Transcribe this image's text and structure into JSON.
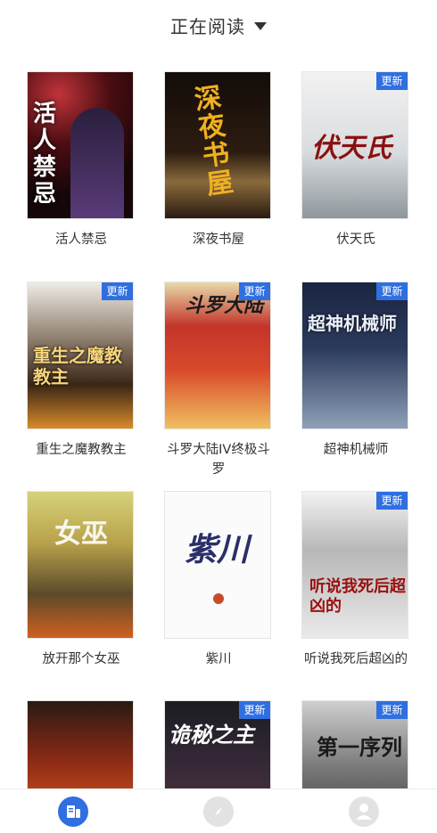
{
  "header": {
    "title": "正在阅读"
  },
  "books": [
    {
      "title": "活人禁忌",
      "cover_text": "活人禁忌",
      "badge": ""
    },
    {
      "title": "深夜书屋",
      "cover_text": "深夜书屋",
      "badge": ""
    },
    {
      "title": "伏天氏",
      "cover_text": "伏天氏",
      "badge": "更新"
    },
    {
      "title": "重生之魔教教主",
      "cover_text": "重生之魔教教主",
      "badge": "更新"
    },
    {
      "title": "斗罗大陆IV终极斗罗",
      "cover_text": "斗罗大陆",
      "badge": "更新"
    },
    {
      "title": "超神机械师",
      "cover_text": "超神机械师",
      "badge": "更新"
    },
    {
      "title": "放开那个女巫",
      "cover_text": "女巫",
      "badge": ""
    },
    {
      "title": "紫川",
      "cover_text": "紫川",
      "badge": ""
    },
    {
      "title": "听说我死后超凶的",
      "cover_text": "听说我死后超凶的",
      "badge": "更新"
    },
    {
      "title": "",
      "cover_text": "",
      "badge": ""
    },
    {
      "title": "",
      "cover_text": "诡秘之主",
      "badge": "更新"
    },
    {
      "title": "",
      "cover_text": "第一序列",
      "badge": "更新"
    }
  ],
  "tabbar": {
    "tabs": [
      {
        "icon": "bookshelf-icon",
        "active": true
      },
      {
        "icon": "compass-icon",
        "active": false
      },
      {
        "icon": "user-icon",
        "active": false
      }
    ]
  }
}
